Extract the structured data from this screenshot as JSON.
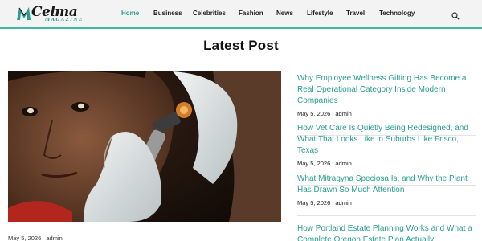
{
  "brand": {
    "name": "Celma",
    "tagline": "MAGAZINE",
    "accent": "#2a9d8f"
  },
  "nav": {
    "items": [
      {
        "label": "Home",
        "active": true
      },
      {
        "label": "Business"
      },
      {
        "label": "Celebrities"
      },
      {
        "label": "Fashion"
      },
      {
        "label": "News"
      },
      {
        "label": "Lifestyle"
      },
      {
        "label": "Travel"
      },
      {
        "label": "Technology"
      }
    ],
    "search_icon": "search-icon"
  },
  "main": {
    "section_title": "Latest Post",
    "featured": {
      "date": "May 5, 2026",
      "author": "admin"
    },
    "posts": [
      {
        "title": "Why Employee Wellness Gifting Has Become a Real Operational Category Inside Modern Companies",
        "date": "May 5, 2026",
        "author": "admin"
      },
      {
        "title": "How Vet Care Is Quietly Being Redesigned, and What That Looks Like in Suburbs Like Frisco, Texas",
        "date": "May 5, 2026",
        "author": "admin"
      },
      {
        "title": "What Mitragyna Speciosa Is, and Why the Plant Has Drawn So Much Attention",
        "date": "May 5, 2026",
        "author": "admin"
      },
      {
        "title": "How Portland Estate Planning Works and What a Complete Oregon Estate Plan Actually",
        "date": "",
        "author": ""
      }
    ]
  }
}
